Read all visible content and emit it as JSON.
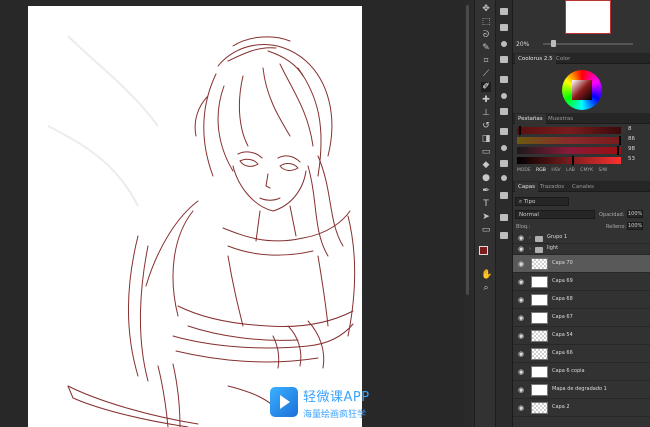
{
  "navigator": {
    "zoom": "20%"
  },
  "color_panel": {
    "tabs": [
      "Coolorus 2.5",
      "Color"
    ],
    "active_tab": 0
  },
  "sliders_panel": {
    "tabs": [
      "Pestañas",
      "Muestras"
    ],
    "values": [
      "8",
      "86",
      "98",
      "53"
    ],
    "modes": [
      "MODE",
      "RGB",
      "HSV",
      "LAB",
      "CMYK",
      "S/W"
    ]
  },
  "layers_panel": {
    "tabs": [
      "Capas",
      "Trazados",
      "Canales"
    ],
    "filter": "Tipo",
    "blend_mode": "Normal",
    "opacity_label": "Opacidad:",
    "opacity": "100%",
    "lock_label": "Bloq.:",
    "fill_label": "Relleno:",
    "fill": "100%",
    "layers": [
      {
        "name": "Grupo 1",
        "type": "group"
      },
      {
        "name": "light",
        "type": "group"
      },
      {
        "name": "Capa 70",
        "type": "layer",
        "selected": true,
        "thumb": "check"
      },
      {
        "name": "Capa 69",
        "type": "layer",
        "thumb": "white"
      },
      {
        "name": "Capa 68",
        "type": "layer",
        "thumb": "white"
      },
      {
        "name": "Capa 67",
        "type": "layer",
        "thumb": "white"
      },
      {
        "name": "Capa 54",
        "type": "layer",
        "thumb": "check"
      },
      {
        "name": "Capa 66",
        "type": "layer",
        "thumb": "check"
      },
      {
        "name": "Capa 6 copia",
        "type": "layer",
        "thumb": "white"
      },
      {
        "name": "Mapa de degradado 1",
        "type": "layer",
        "thumb": "white"
      },
      {
        "name": "Capa 2",
        "type": "layer",
        "thumb": "check"
      }
    ]
  },
  "watermark": {
    "title": "轻微课APP",
    "subtitle": "海量绘画疯狂学"
  },
  "colors": {
    "foreground": "#7a1c1c",
    "background": "#ffffff",
    "line_art": "#7a1a1a"
  },
  "tool_icons": [
    "move-icon",
    "marquee-icon",
    "lasso-icon",
    "quick-select-icon",
    "crop-icon",
    "eyedropper-icon",
    "healing-icon",
    "brush-icon",
    "stamp-icon",
    "history-brush-icon",
    "eraser-icon",
    "gradient-icon",
    "blur-icon",
    "dodge-icon",
    "pen-icon",
    "type-icon",
    "path-select-icon",
    "shape-icon",
    "hand-icon",
    "zoom-icon"
  ]
}
